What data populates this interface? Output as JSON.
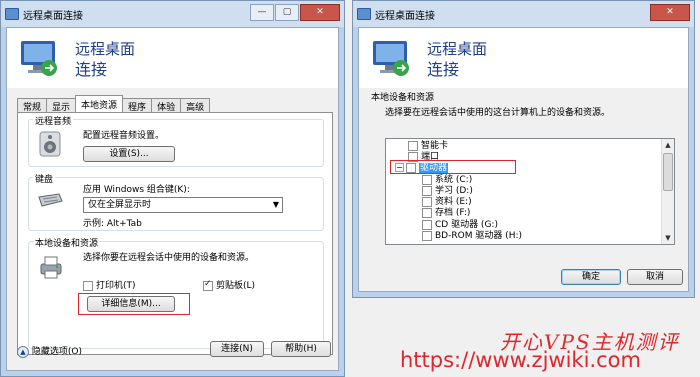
{
  "left_window": {
    "title": "远程桌面连接",
    "header_line1": "远程桌面",
    "header_line2": "连接",
    "tabs": [
      "常规",
      "显示",
      "本地资源",
      "程序",
      "体验",
      "高级"
    ],
    "audio": {
      "group_title": "远程音频",
      "desc": "配置远程音频设置。",
      "settings_button": "设置(S)..."
    },
    "keyboard": {
      "group_title": "键盘",
      "label": "应用 Windows 组合键(K):",
      "selected": "仅在全屏显示时",
      "example": "示例: Alt+Tab"
    },
    "devices": {
      "group_title": "本地设备和资源",
      "desc": "选择你要在远程会话中使用的设备和资源。",
      "printer_label": "打印机(T)",
      "printer_checked": false,
      "clipboard_label": "剪贴板(L)",
      "clipboard_checked": true,
      "details_button": "详细信息(M)..."
    },
    "hide_options": "隐藏选项(O)",
    "connect_button": "连接(N)",
    "help_button": "帮助(H)"
  },
  "right_window": {
    "title": "远程桌面连接",
    "header_line1": "远程桌面",
    "header_line2": "连接",
    "group_title": "本地设备和资源",
    "desc": "选择要在远程会话中使用的这台计算机上的设备和资源。",
    "tree": [
      {
        "label": "智能卡",
        "indent": 1,
        "expander": ""
      },
      {
        "label": "端口",
        "indent": 1,
        "expander": ""
      },
      {
        "label": "驱动器",
        "indent": 0,
        "expander": "−",
        "selected": true
      },
      {
        "label": "系统 (C:)",
        "indent": 2,
        "expander": ""
      },
      {
        "label": "学习 (D:)",
        "indent": 2,
        "expander": ""
      },
      {
        "label": "资料 (E:)",
        "indent": 2,
        "expander": ""
      },
      {
        "label": "存档 (F:)",
        "indent": 2,
        "expander": ""
      },
      {
        "label": "CD 驱动器 (G:)",
        "indent": 2,
        "expander": ""
      },
      {
        "label": "BD-ROM 驱动器 (H:)",
        "indent": 2,
        "expander": ""
      }
    ],
    "ok_button": "确定",
    "cancel_button": "取消"
  },
  "watermark": {
    "text1": "开心VPS主机测评",
    "text2": "https://www.zjwiki.com",
    "color": "#e0262c"
  },
  "colors": {
    "highlight_box": "#e0262c",
    "header_text": "#1e3f8a",
    "selection": "#3399ff"
  }
}
